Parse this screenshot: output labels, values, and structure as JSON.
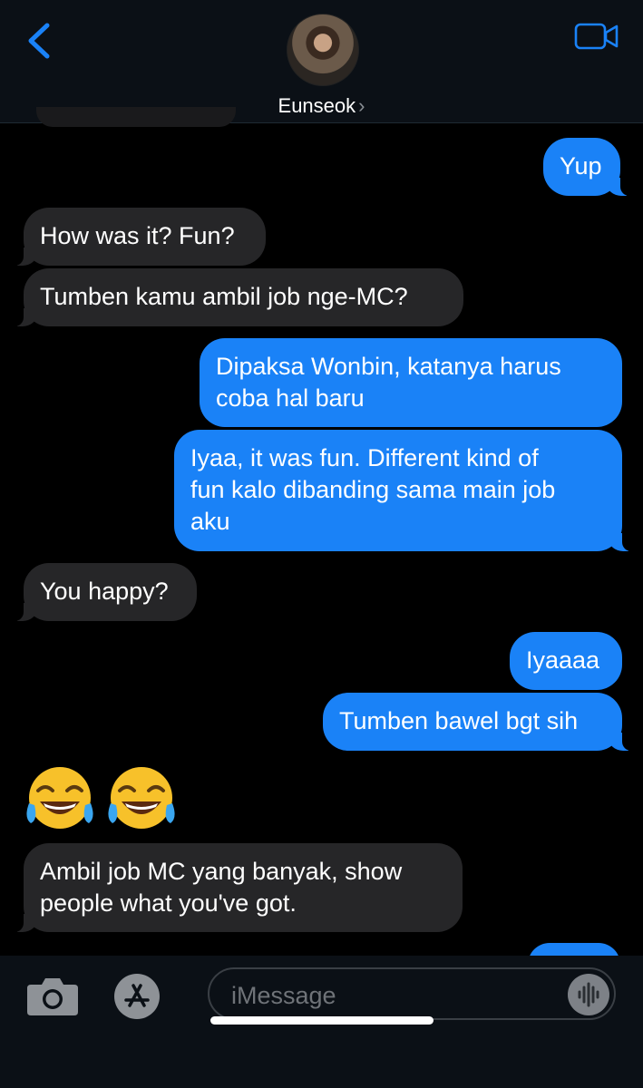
{
  "header": {
    "contact_name": "Eunseok",
    "chevron": "›",
    "back_icon": "chevron-left-icon",
    "video_icon": "video-camera-icon",
    "accent_color": "#1a82f7"
  },
  "messages": [
    {
      "direction": "out",
      "text": "Yup"
    },
    {
      "direction": "in",
      "text": "How was it? Fun?"
    },
    {
      "direction": "in",
      "text": "Tumben kamu ambil job nge-MC?"
    },
    {
      "direction": "out",
      "text": "Dipaksa Wonbin, katanya harus\ncoba hal baru"
    },
    {
      "direction": "out",
      "text": "Iyaa, it was fun. Different kind of\nfun kalo dibanding sama main job\naku"
    },
    {
      "direction": "in",
      "text": "You happy?"
    },
    {
      "direction": "out",
      "text": "Iyaaaa"
    },
    {
      "direction": "out",
      "text": "Tumben bawel bgt sih"
    },
    {
      "direction": "in",
      "type": "emoji",
      "text": "😂😂"
    },
    {
      "direction": "in",
      "text": "Ambil job MC yang banyak, show\npeople what you've got."
    }
  ],
  "input": {
    "placeholder": "iMessage",
    "camera_icon": "camera-icon",
    "apps_icon": "app-store-icon",
    "audio_icon": "audio-waveform-icon"
  },
  "colors": {
    "incoming_bubble": "#262628",
    "outgoing_bubble": "#1a82f7",
    "background": "#000000"
  }
}
